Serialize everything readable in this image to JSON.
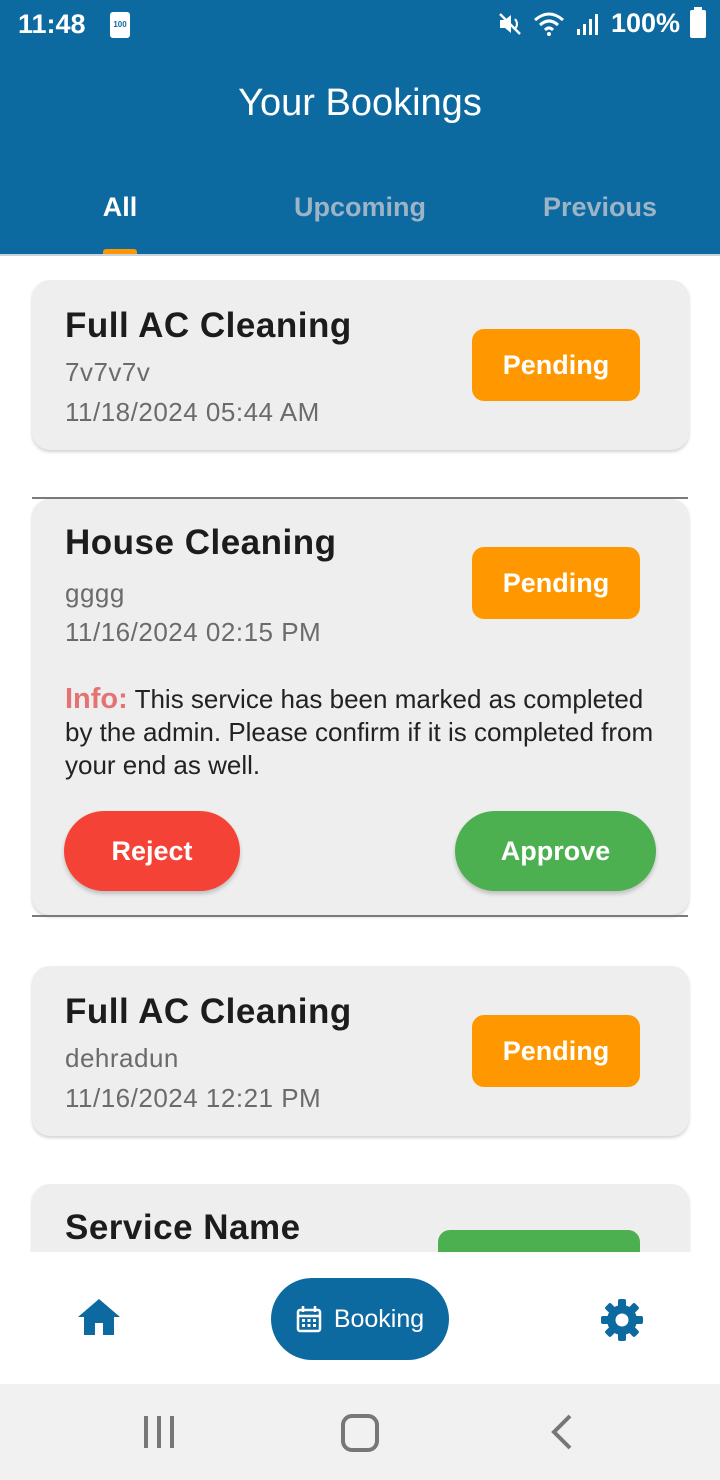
{
  "status_bar": {
    "time": "11:48",
    "battery_icon_label": "100",
    "battery_percent": "100%"
  },
  "header": {
    "title": "Your Bookings",
    "tabs": [
      {
        "label": "All",
        "active": true
      },
      {
        "label": "Upcoming",
        "active": false
      },
      {
        "label": "Previous",
        "active": false
      }
    ]
  },
  "bookings": [
    {
      "service": "Full AC Cleaning",
      "location": "7v7v7v",
      "datetime": "11/18/2024 05:44 AM",
      "status": "Pending"
    },
    {
      "service": "House Cleaning",
      "location": "gggg",
      "datetime": "11/16/2024 02:15 PM",
      "status": "Pending",
      "info_label": "Info:",
      "info_text": "This service has been marked as completed by the admin. Please confirm if it is completed from your end as well.",
      "reject_label": "Reject",
      "approve_label": "Approve"
    },
    {
      "service": "Full AC Cleaning",
      "location": "dehradun",
      "datetime": "11/16/2024 12:21 PM",
      "status": "Pending"
    },
    {
      "service": "Service Name"
    }
  ],
  "bottom_nav": {
    "home_icon": "home-icon",
    "booking_label": "Booking",
    "booking_icon": "calendar-icon",
    "settings_icon": "gear-icon"
  },
  "colors": {
    "primary": "#0d6aa1",
    "pending": "#ff9800",
    "reject": "#f44336",
    "approve": "#4caf50",
    "info_label": "#e57373",
    "tab_indicator": "#ff9800"
  }
}
